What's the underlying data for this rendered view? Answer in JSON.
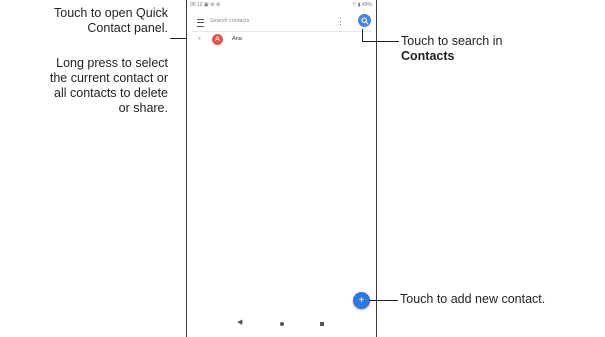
{
  "callouts": {
    "quick_contact_line1": "Touch to open Quick",
    "quick_contact_line2": "Contact panel.",
    "long_press_line1": "Long press to select",
    "long_press_line2": "the current contact or",
    "long_press_line3": "all contacts to delete",
    "long_press_line4": "or share.",
    "search_line1": "Touch to search in",
    "search_line2": "Contacts",
    "add_contact": "Touch to add new contact."
  },
  "phone": {
    "status_time": "05:12",
    "status_icons_left": "▣ ⚙ ⚙",
    "status_right": "▽ ▮ 49%",
    "search_placeholder": "Search contacts",
    "kebab_symbol": "⋮",
    "contact": {
      "star": "★",
      "avatar_letter": "A",
      "name": "Ana"
    },
    "fab_symbol": "+",
    "nav": {
      "back_symbol": "◀"
    }
  },
  "colors": {
    "search_button": "#4a84d9",
    "avatar": "#e0574a",
    "fab": "#2e78e0"
  }
}
